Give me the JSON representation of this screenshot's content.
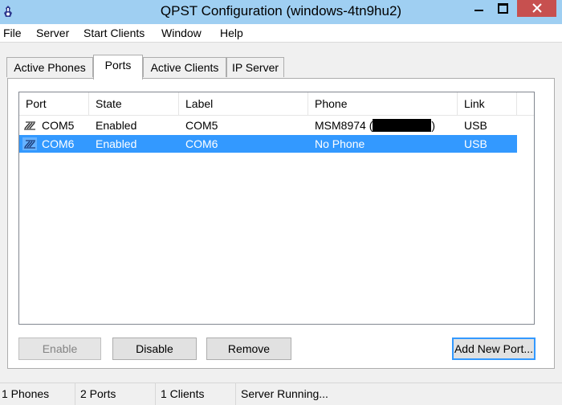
{
  "window": {
    "title": "QPST Configuration (windows-4tn9hu2)"
  },
  "menu": [
    "File",
    "Server",
    "Start Clients",
    "Window",
    "Help"
  ],
  "tabs": [
    "Active Phones",
    "Ports",
    "Active Clients",
    "IP Server"
  ],
  "active_tab": "Ports",
  "columns": [
    "Port",
    "State",
    "Label",
    "Phone",
    "Link"
  ],
  "rows": [
    {
      "port": "COM5",
      "state": "Enabled",
      "label": "COM5",
      "phone_prefix": "MSM8974 (",
      "phone_suffix": ")",
      "link": "USB",
      "selected": false
    },
    {
      "port": "COM6",
      "state": "Enabled",
      "label": "COM6",
      "phone": "No Phone",
      "link": "USB",
      "selected": true
    }
  ],
  "buttons": {
    "enable": "Enable",
    "disable": "Disable",
    "remove": "Remove",
    "add_new_port": "Add New Port..."
  },
  "status": {
    "phones": "1 Phones",
    "ports": "2 Ports",
    "clients": "1 Clients",
    "server": "Server Running..."
  },
  "colors": {
    "titlebar": "#9fcff2",
    "close": "#c7504f",
    "selection": "#3399ff"
  },
  "icons": {
    "app": "qpst-app-icon",
    "port": "serial-port-icon"
  }
}
